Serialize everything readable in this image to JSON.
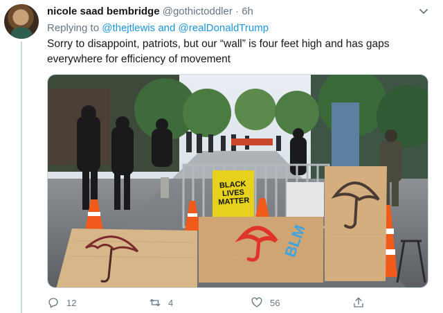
{
  "tweet": {
    "display_name": "nicole saad bembridge",
    "handle": "@gothictoddler",
    "separator": "·",
    "time": "6h",
    "replying_prefix": "Replying to",
    "replying_to": [
      "@thejtlewis",
      "@realDonaldTrump"
    ],
    "replying_joiner": "and",
    "text": "Sorry to disappoint, patriots, but our “wall” is four feet high and has gaps everywhere for efficiency of movement",
    "photo": {
      "sign_text": "BLACK LIVES MATTER",
      "board_text": "BLM"
    },
    "counts": {
      "replies": "12",
      "retweets": "4",
      "likes": "56"
    }
  },
  "icons": {
    "menu": "chevron-down-icon",
    "reply": "reply-icon",
    "retweet": "retweet-icon",
    "like": "heart-icon",
    "share": "share-icon"
  },
  "colors": {
    "link": "#1b95e0",
    "muted": "#657786",
    "text": "#14171a"
  }
}
